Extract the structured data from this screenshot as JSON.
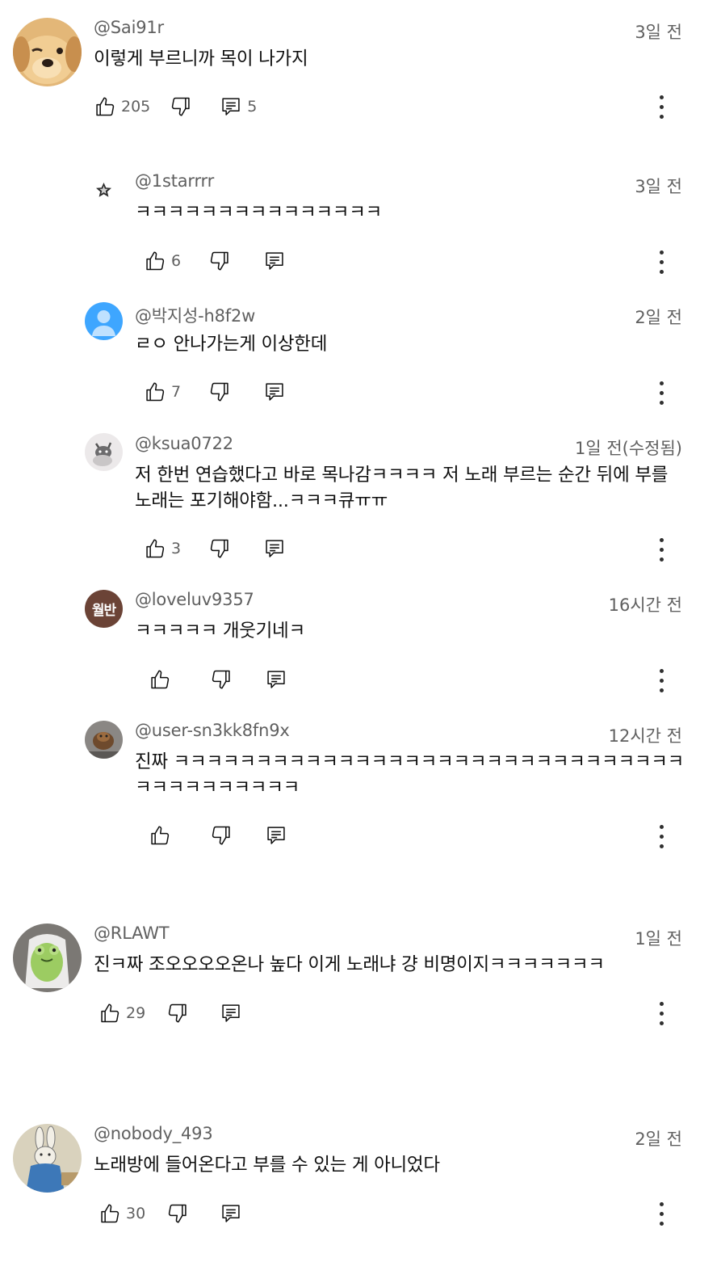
{
  "comments": [
    {
      "handle": "@Sai91r",
      "time": "3일 전",
      "text": "이렇게 부르니까 목이 나가지",
      "likes": "205",
      "replies": "5"
    },
    {
      "handle": "@1starrrr",
      "time": "3일 전",
      "text": "ㅋㅋㅋㅋㅋㅋㅋㅋㅋㅋㅋㅋㅋㅋㅋ",
      "likes": "6"
    },
    {
      "handle": "@박지성-h8f2w",
      "time": "2일 전",
      "text": "ㄹㅇ 안나가는게 이상한데",
      "likes": "7"
    },
    {
      "handle": "@ksua0722",
      "time": "1일 전(수정됨)",
      "text": "저 한번 연습했다고 바로 목나감ㅋㅋㅋㅋ 저 노래 부르는 순간 뒤에 부를 노래는 포기해야함...ㅋㅋㅋ큐ㅠㅠ",
      "likes": "3"
    },
    {
      "handle": "@loveluv9357",
      "time": "16시간 전",
      "text": "ㅋㅋㅋㅋㅋ 개웃기네ㅋ",
      "likes": "",
      "avatar_text": "월반"
    },
    {
      "handle": "@user-sn3kk8fn9x",
      "time": "12시간 전",
      "text": "진짜 ㅋㅋㅋㅋㅋㅋㅋㅋㅋㅋㅋㅋㅋㅋㅋㅋㅋㅋㅋㅋㅋㅋㅋㅋㅋㅋㅋㅋㅋㅋㅋㅋㅋㅋㅋㅋㅋㅋㅋㅋㅋ",
      "likes": ""
    },
    {
      "handle": "@RLAWT",
      "time": "1일 전",
      "text": "진ㅋ짜 조오오오오온나 높다 이게 노래냐 걍 비명이지ㅋㅋㅋㅋㅋㅋㅋ",
      "likes": "29"
    },
    {
      "handle": "@nobody_493",
      "time": "2일 전",
      "text": "노래방에 들어온다고 부를 수 있는 게 아니었다",
      "likes": "30"
    }
  ],
  "icons": {
    "like": "thumb-up-icon",
    "dislike": "thumb-down-icon",
    "reply": "comment-icon",
    "more": "more-vert-icon"
  },
  "colors": {
    "secondary_text": "#606060",
    "primary_text": "#0f0f0f",
    "default_avatar": "#3ea6ff"
  }
}
